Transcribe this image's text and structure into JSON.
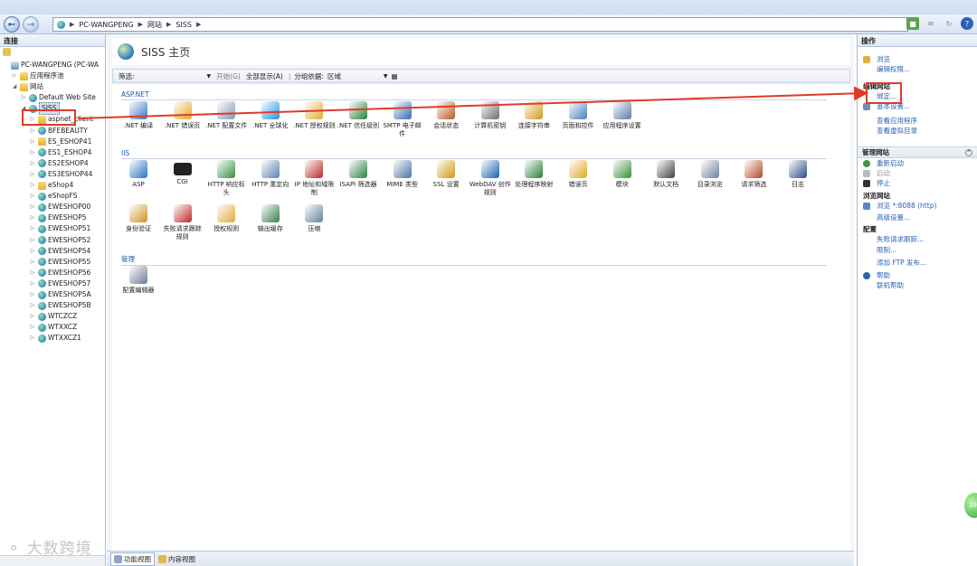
{
  "address": {
    "crumbs": [
      "PC-WANGPENG",
      "网站",
      "SISS"
    ]
  },
  "left_pane": {
    "title": "连接",
    "tree": [
      {
        "label": "PC-WANGPENG (PC-WA",
        "indent": 0,
        "icon": "computer-icon"
      },
      {
        "label": "应用程序池",
        "indent": 1,
        "icon": "app-pool-icon"
      },
      {
        "label": "网站",
        "indent": 1,
        "icon": "folder-icon",
        "expanded": true
      },
      {
        "label": "Default Web Site",
        "indent": 2,
        "icon": "globe-icon"
      },
      {
        "label": "SISS",
        "indent": 2,
        "icon": "globe-icon",
        "expanded": true,
        "selected": true
      },
      {
        "label": "aspnet_client",
        "indent": 3,
        "icon": "folder-icon"
      },
      {
        "label": "BFEBEAUTY",
        "indent": 3,
        "icon": "app-icon"
      },
      {
        "label": "ES_ESHOP41",
        "indent": 3,
        "icon": "folder-icon"
      },
      {
        "label": "ES1_ESHOP4",
        "indent": 3,
        "icon": "app-icon"
      },
      {
        "label": "ES2ESHOP4",
        "indent": 3,
        "icon": "app-icon"
      },
      {
        "label": "ES3ESHOP44",
        "indent": 3,
        "icon": "app-icon"
      },
      {
        "label": "eShop4",
        "indent": 3,
        "icon": "folder-icon"
      },
      {
        "label": "eShopFS",
        "indent": 3,
        "icon": "app-icon"
      },
      {
        "label": "EWESHOP00",
        "indent": 3,
        "icon": "app-icon"
      },
      {
        "label": "EWESHOP5",
        "indent": 3,
        "icon": "app-icon"
      },
      {
        "label": "EWESHOP51",
        "indent": 3,
        "icon": "app-icon"
      },
      {
        "label": "EWESHOP52",
        "indent": 3,
        "icon": "app-icon"
      },
      {
        "label": "EWESHOP54",
        "indent": 3,
        "icon": "app-icon"
      },
      {
        "label": "EWESHOP55",
        "indent": 3,
        "icon": "app-icon"
      },
      {
        "label": "EWESHOP56",
        "indent": 3,
        "icon": "app-icon"
      },
      {
        "label": "EWESHOP57",
        "indent": 3,
        "icon": "app-icon"
      },
      {
        "label": "EWESHOP5A",
        "indent": 3,
        "icon": "app-icon"
      },
      {
        "label": "EWESHOP5B",
        "indent": 3,
        "icon": "app-icon"
      },
      {
        "label": "WTCZCZ",
        "indent": 3,
        "icon": "app-icon"
      },
      {
        "label": "WTXXCZ",
        "indent": 3,
        "icon": "app-icon"
      },
      {
        "label": "WTXXCZ1",
        "indent": 3,
        "icon": "app-icon"
      }
    ]
  },
  "center": {
    "title": "SISS 主页",
    "filter": {
      "label": "筛选:",
      "go": "开始(G)",
      "show_all": "全部显示(A)",
      "group_by": "分组依据:",
      "group_value": "区域"
    },
    "groups": [
      {
        "name": "ASP.NET",
        "items": [
          {
            "label": ".NET 编译",
            "icon": "dotnet-compile-icon",
            "color": "#4a84c9"
          },
          {
            "label": ".NET 错误页",
            "icon": "dotnet-error-pages-icon",
            "color": "#e2b23b"
          },
          {
            "label": ".NET 配置文件",
            "icon": "dotnet-profile-icon",
            "color": "#8fa3bd"
          },
          {
            "label": ".NET 全球化",
            "icon": "dotnet-globalization-icon",
            "color": "#3a9de0"
          },
          {
            "label": ".NET 授权规则",
            "icon": "dotnet-authorization-icon",
            "color": "#e8b544"
          },
          {
            "label": ".NET 信任级别",
            "icon": "dotnet-trust-icon",
            "color": "#3d8f4a"
          },
          {
            "label": "SMTP 电子邮件",
            "icon": "smtp-email-icon",
            "color": "#4a78b8"
          },
          {
            "label": "会话状态",
            "icon": "session-state-icon",
            "color": "#c1693a"
          },
          {
            "label": "计算机密钥",
            "icon": "machine-key-icon",
            "color": "#7a7a7a"
          },
          {
            "label": "连接字符串",
            "icon": "connection-strings-icon",
            "color": "#d9a12f"
          },
          {
            "label": "页面和控件",
            "icon": "pages-controls-icon",
            "color": "#5c8ac4"
          },
          {
            "label": "应用程序设置",
            "icon": "app-settings-icon",
            "color": "#6d87ad"
          }
        ]
      },
      {
        "name": "IIS",
        "items": [
          {
            "label": "ASP",
            "icon": "asp-icon",
            "color": "#3f7fc7"
          },
          {
            "label": "CGI",
            "icon": "cgi-icon",
            "color": "#222222"
          },
          {
            "label": "HTTP 响应标头",
            "icon": "http-headers-icon",
            "color": "#4b9a4f"
          },
          {
            "label": "HTTP 重定向",
            "icon": "http-redirect-icon",
            "color": "#6b8fb8"
          },
          {
            "label": "IP 地址和域限制",
            "icon": "ip-restrictions-icon",
            "color": "#c23a3a"
          },
          {
            "label": "ISAPI 筛选器",
            "icon": "isapi-filters-icon",
            "color": "#3e8e5a"
          },
          {
            "label": "MIME 类型",
            "icon": "mime-types-icon",
            "color": "#5c7fb0"
          },
          {
            "label": "SSL 设置",
            "icon": "ssl-settings-icon",
            "color": "#d4a22a"
          },
          {
            "label": "WebDAV 创作规则",
            "icon": "webdav-icon",
            "color": "#2f6fb8"
          },
          {
            "label": "处理程序映射",
            "icon": "handler-mappings-icon",
            "color": "#3f8b45"
          },
          {
            "label": "错误页",
            "icon": "error-pages-icon",
            "color": "#e2b23b"
          },
          {
            "label": "模块",
            "icon": "modules-icon",
            "color": "#4a9a4a"
          },
          {
            "label": "默认文档",
            "icon": "default-document-icon",
            "color": "#555555"
          },
          {
            "label": "目录浏览",
            "icon": "directory-browsing-icon",
            "color": "#7d8fa8"
          },
          {
            "label": "请求筛选",
            "icon": "request-filtering-icon",
            "color": "#b85c3a"
          },
          {
            "label": "日志",
            "icon": "logging-icon",
            "color": "#3c5f8f"
          },
          {
            "label": "身份验证",
            "icon": "authentication-icon",
            "color": "#d49a3a"
          },
          {
            "label": "失败请求跟踪规则",
            "icon": "failed-request-tracing-icon",
            "color": "#c73a3a"
          },
          {
            "label": "授权规则",
            "icon": "authorization-rules-icon",
            "color": "#e3b14a"
          },
          {
            "label": "输出缓存",
            "icon": "output-caching-icon",
            "color": "#4a8a5a"
          },
          {
            "label": "压缩",
            "icon": "compression-icon",
            "color": "#6f8fa8"
          }
        ]
      },
      {
        "name": "管理",
        "items": [
          {
            "label": "配置编辑器",
            "icon": "configuration-editor-icon",
            "color": "#7a8aa0"
          }
        ]
      }
    ],
    "view_tabs": [
      "功能视图",
      "内容视图"
    ]
  },
  "right_pane": {
    "title": "操作",
    "top_links": [
      "浏览",
      "编辑权限..."
    ],
    "edit_site": {
      "head": "编辑网站",
      "links": [
        "绑定...",
        "基本设置...",
        "查看应用程序",
        "查看虚拟目录"
      ]
    },
    "manage_site": {
      "head": "管理网站",
      "links": [
        "重新启动",
        "启动",
        "停止"
      ]
    },
    "browse_site": {
      "head": "浏览网站",
      "links": [
        "浏览 *:8088 (http)",
        "高级设置..."
      ]
    },
    "configure": {
      "head": "配置",
      "links": [
        "失败请求跟踪...",
        "限制...",
        "添加 FTP 发布..."
      ]
    },
    "help": [
      "帮助",
      "联机帮助"
    ]
  },
  "watermark": "大数跨境",
  "bubble": "39",
  "colors": {
    "annotation": "#e03a2a",
    "link": "#2a62b7",
    "group": "#1e5aa8"
  }
}
